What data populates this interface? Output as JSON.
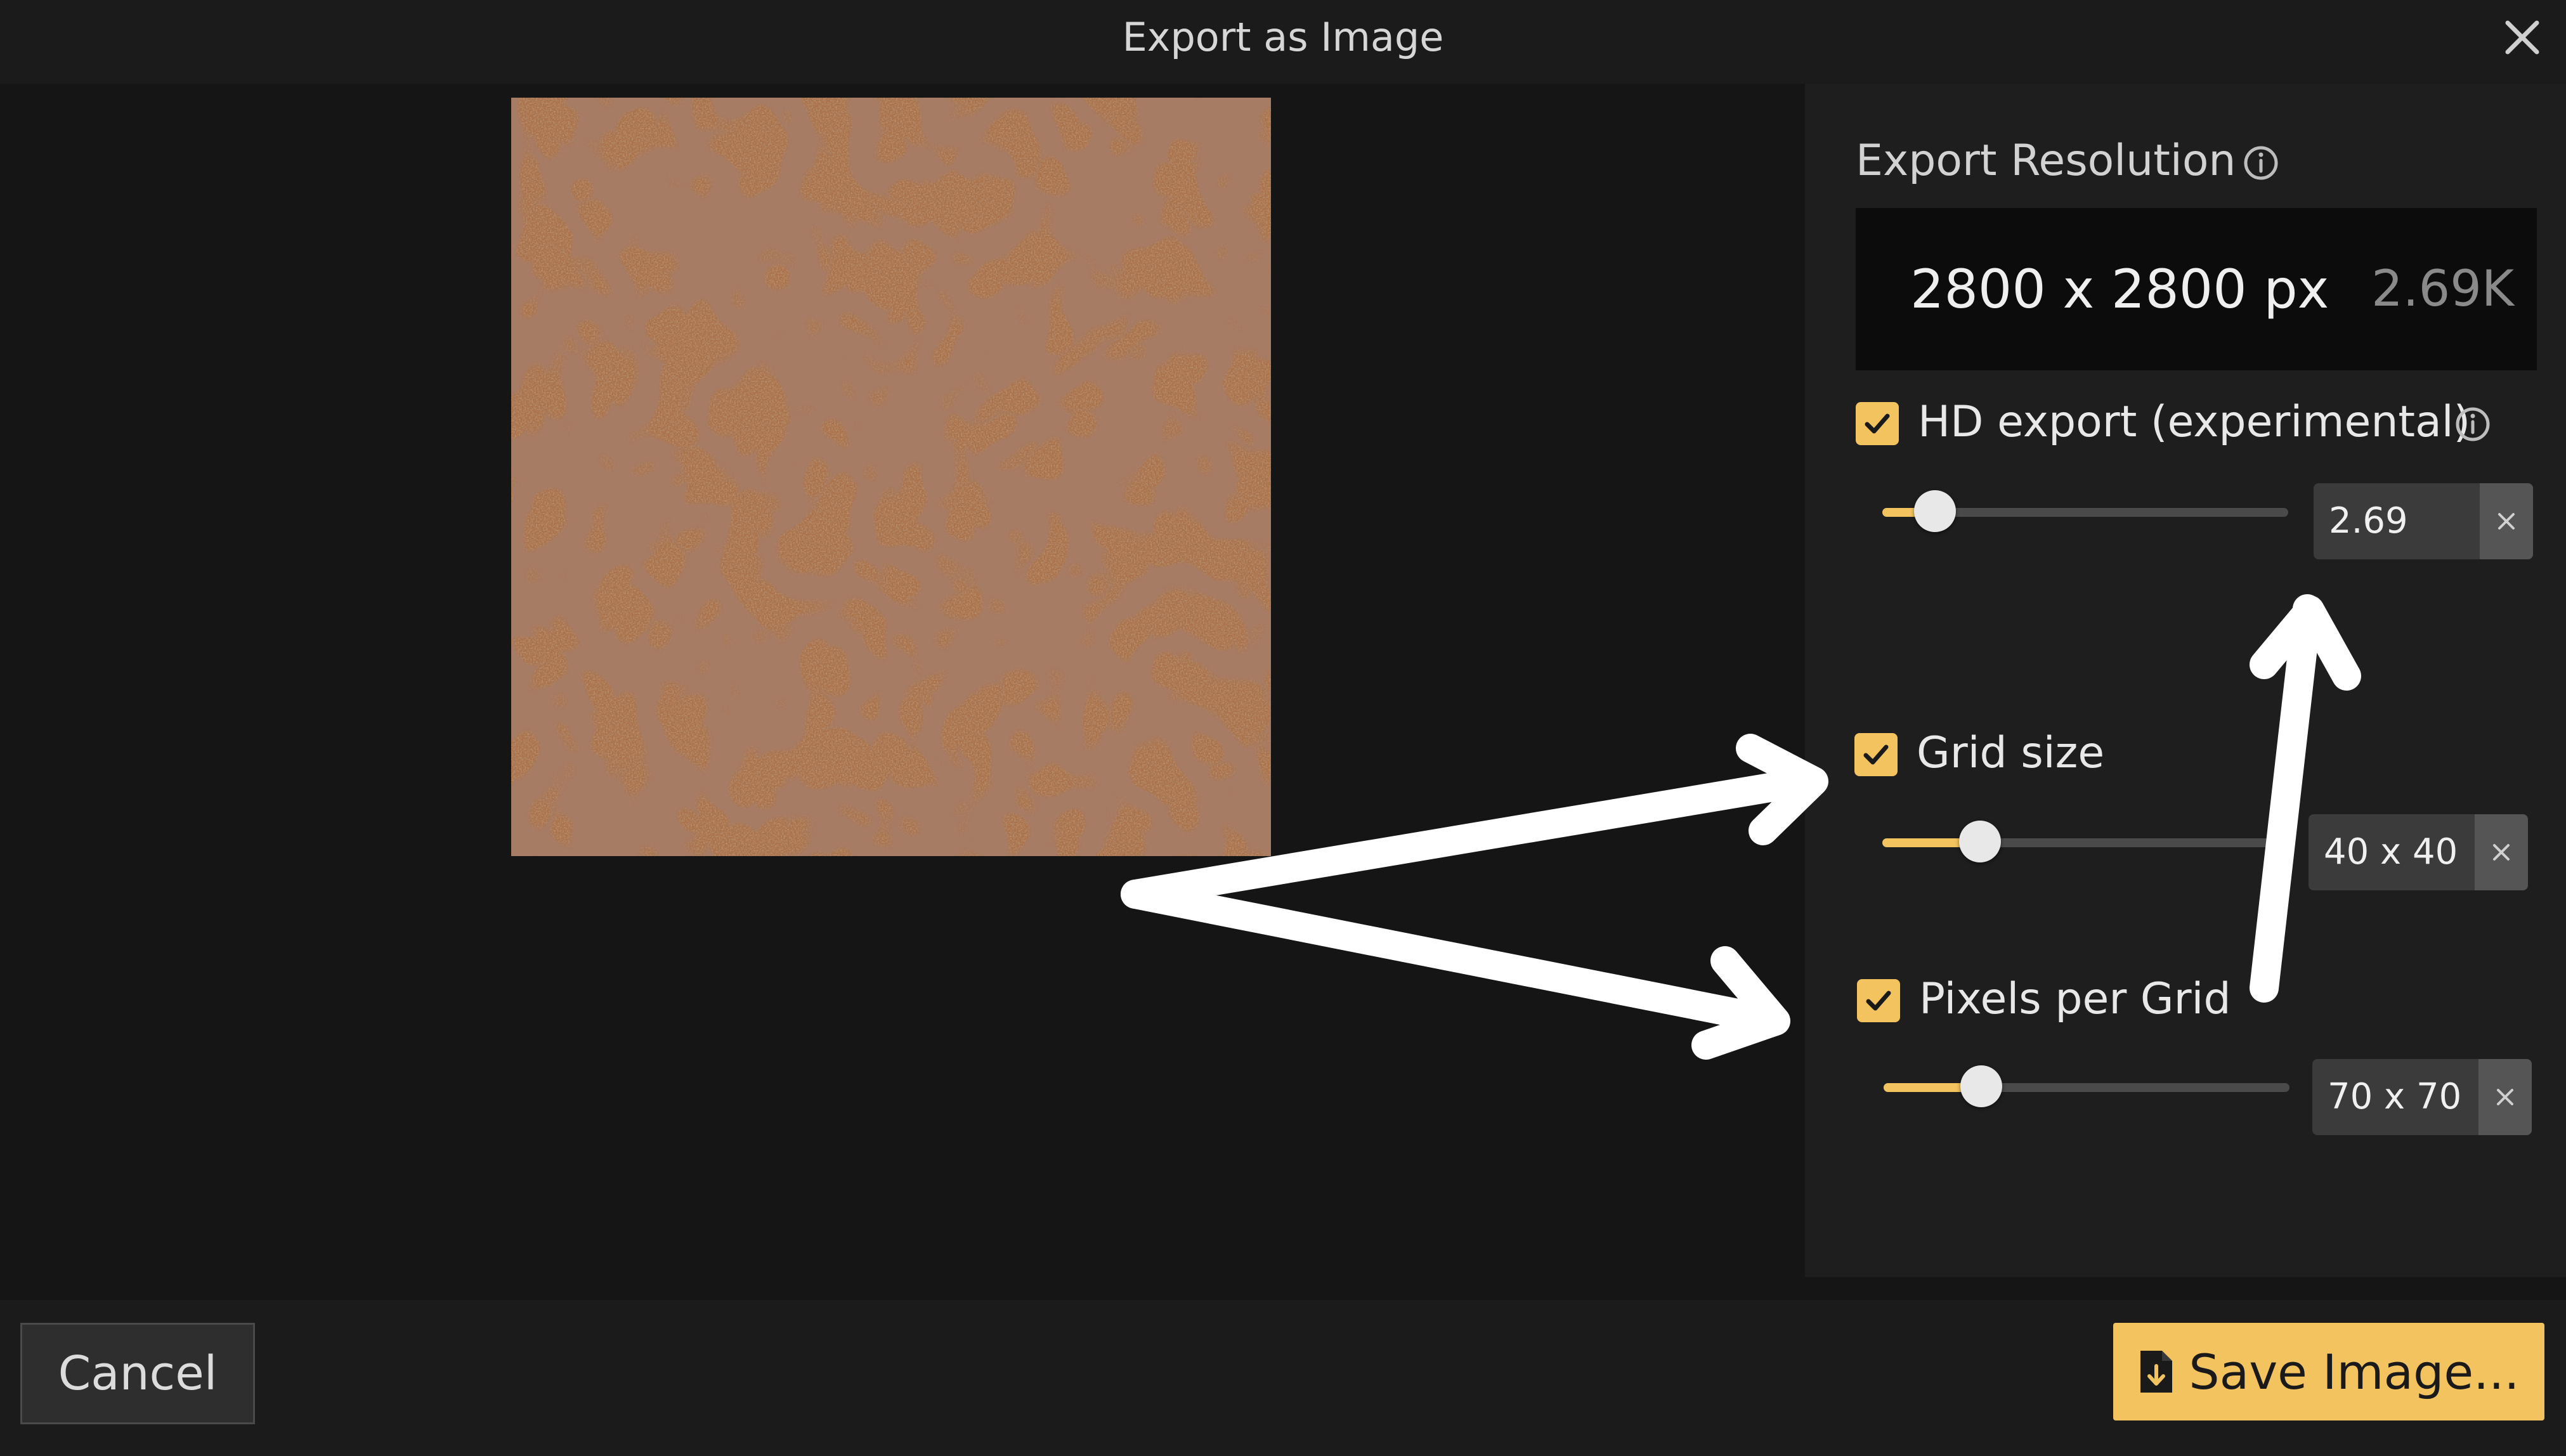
{
  "dialog": {
    "title": "Export as Image",
    "close_icon": "close-icon"
  },
  "export_resolution": {
    "title": "Export Resolution",
    "value": "2800 x 2800 px",
    "short": "2.69K",
    "info_icon": "info-icon"
  },
  "hd_export": {
    "label": "HD export (experimental)",
    "checked": true,
    "slider_fraction": 0.13,
    "value": "2.69",
    "info_icon": "info-icon"
  },
  "grid_size": {
    "label": "Grid size",
    "checked": true,
    "slider_fraction": 0.24,
    "value": "40 x 40"
  },
  "pixels_per_grid": {
    "label": "Pixels per Grid",
    "checked": true,
    "slider_fraction": 0.24,
    "value": "70 x 70"
  },
  "footer": {
    "cancel_label": "Cancel",
    "save_label": "Save Image...",
    "save_icon": "file-download-icon"
  },
  "colors": {
    "accent": "#f2c35e",
    "background": "#151515",
    "panel": "#1e1e1e"
  }
}
